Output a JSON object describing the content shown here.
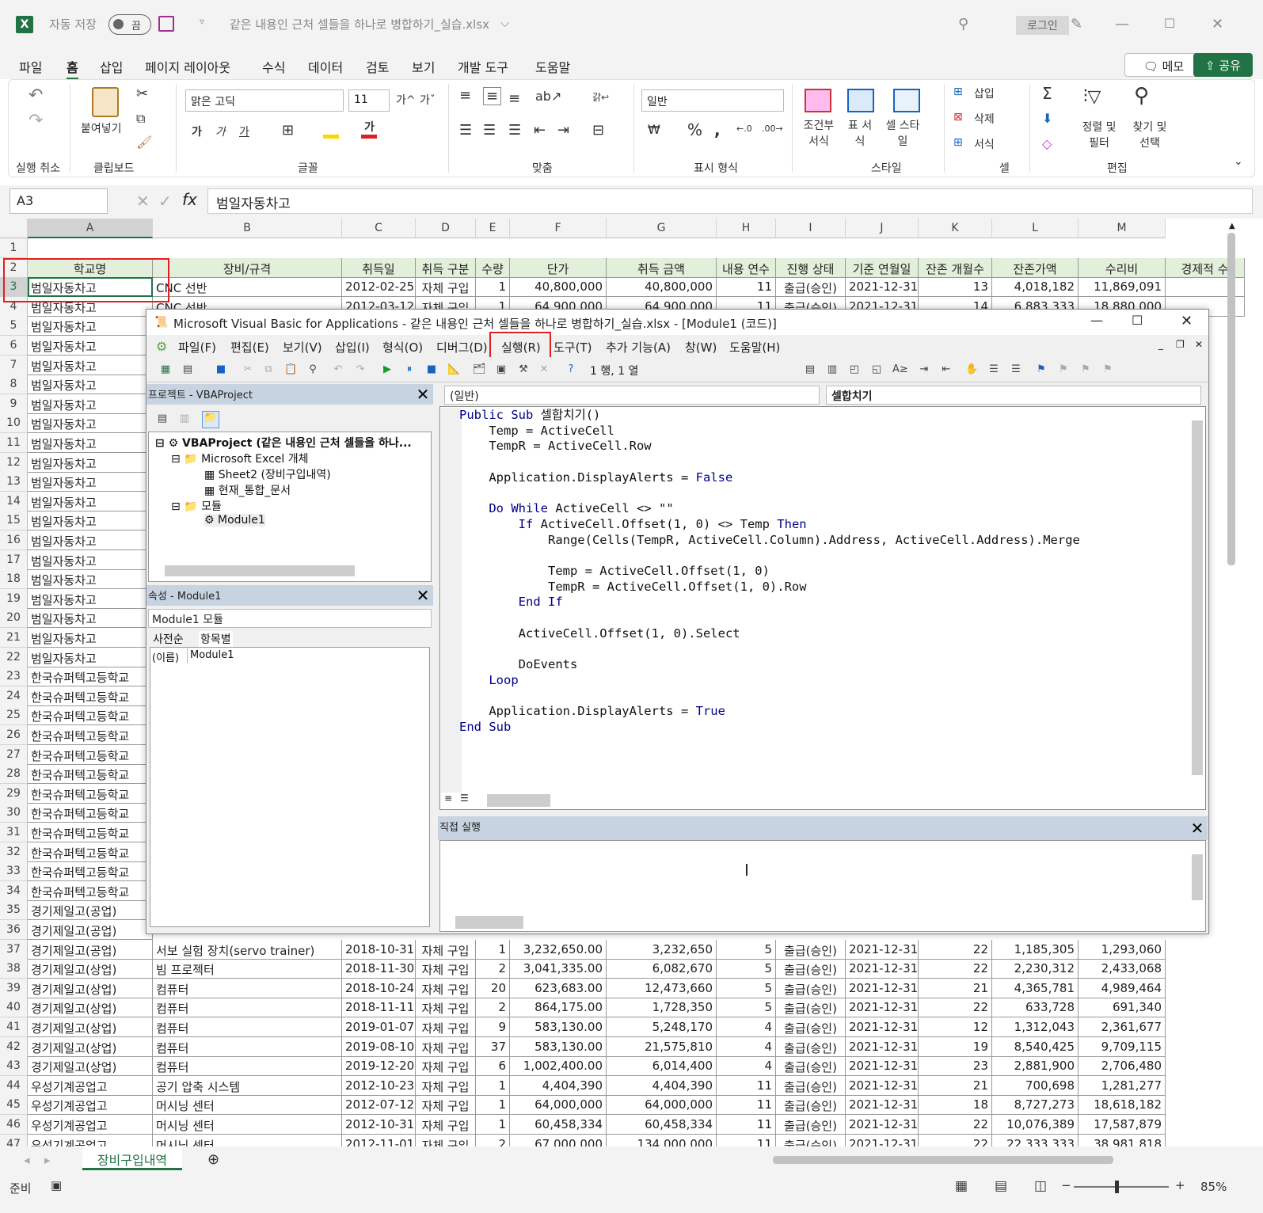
{
  "titlebar": {
    "autosave_label": "자동 저장",
    "autosave_state": "끔",
    "filename": "같은 내용인 근처 셀들을 하나로 병합하기_실습.xlsx",
    "login": "로그인"
  },
  "menu": {
    "tabs": [
      "파일",
      "홈",
      "삽입",
      "페이지 레이아웃",
      "수식",
      "데이터",
      "검토",
      "보기",
      "개발 도구",
      "도움말"
    ],
    "active": "홈",
    "memo": "메모",
    "share": "공유"
  },
  "ribbon": {
    "paste": "붙여넣기",
    "font_name": "맑은 고딕",
    "font_size": "11",
    "number_format": "일반",
    "conditional": "조건부 서식",
    "table": "표 서식",
    "cell_style": "셀 스타일",
    "insert": "삽입",
    "delete": "삭제",
    "format": "서식",
    "sort_filter": "정렬 및 필터",
    "find_select": "찾기 및 선택",
    "groups": {
      "undo": "실행 취소",
      "clipboard": "클립보드",
      "font": "글꼴",
      "align": "맞춤",
      "number": "표시 형식",
      "style": "스타일",
      "cells": "셀",
      "edit": "편집"
    }
  },
  "formula": {
    "namebox": "A3",
    "content": "범일자동차고"
  },
  "columns": [
    "A",
    "B",
    "C",
    "D",
    "E",
    "F",
    "G",
    "H",
    "I",
    "J",
    "K",
    "L",
    "M"
  ],
  "headers": [
    "학교명",
    "장비/규격",
    "취득일",
    "취득 구분",
    "수량",
    "단가",
    "취득 금액",
    "내용 연수",
    "진행 상태",
    "기준 연월일",
    "잔존 개월수",
    "잔존가액",
    "수리비",
    "경제적 수"
  ],
  "rows_top": [
    [
      "범일자동차고",
      "CNC 선반",
      "2012-02-25",
      "자체 구입",
      "1",
      "40,800,000",
      "40,800,000",
      "11",
      "출급(승인)",
      "2021-12-31",
      "13",
      "4,018,182",
      "11,869,091",
      ""
    ],
    [
      "범일자동차고",
      "CNC 선반",
      "2012-03-12",
      "자체 구입",
      "1",
      "64,900,000",
      "64,900,000",
      "11",
      "출급(승인)",
      "2021-12-31",
      "14",
      "6,883,333",
      "18,880,000",
      ""
    ]
  ],
  "colA_hidden": [
    "범일자동차고",
    "범일자동차고",
    "범일자동차고",
    "범일자동차고",
    "범일자동차고",
    "범일자동차고",
    "범일자동차고",
    "범일자동차고",
    "범일자동차고",
    "범일자동차고",
    "범일자동차고",
    "범일자동차고",
    "범일자동차고",
    "범일자동차고",
    "범일자동차고",
    "범일자동차고",
    "범일자동차고",
    "범일자동차고",
    "한국슈퍼텍고등학교",
    "한국슈퍼텍고등학교",
    "한국슈퍼텍고등학교",
    "한국슈퍼텍고등학교",
    "한국슈퍼텍고등학교",
    "한국슈퍼텍고등학교",
    "한국슈퍼텍고등학교",
    "한국슈퍼텍고등학교",
    "한국슈퍼텍고등학교",
    "한국슈퍼텍고등학교",
    "한국슈퍼텍고등학교",
    "한국슈퍼텍고등학교",
    "경기제일고(공업)",
    "경기제일고(공업)"
  ],
  "rows_bottom": [
    [
      "경기제일고(공업)",
      "서보 실험 장치(servo trainer)",
      "2018-10-31",
      "자체 구입",
      "1",
      "3,232,650.00",
      "3,232,650",
      "5",
      "출급(승인)",
      "2021-12-31",
      "22",
      "1,185,305",
      "1,293,060"
    ],
    [
      "경기제일고(상업)",
      "빔 프로젝터",
      "2018-11-30",
      "자체 구입",
      "2",
      "3,041,335.00",
      "6,082,670",
      "5",
      "출급(승인)",
      "2021-12-31",
      "22",
      "2,230,312",
      "2,433,068"
    ],
    [
      "경기제일고(상업)",
      "컴퓨터",
      "2018-10-24",
      "자체 구입",
      "20",
      "623,683.00",
      "12,473,660",
      "5",
      "출급(승인)",
      "2021-12-31",
      "21",
      "4,365,781",
      "4,989,464"
    ],
    [
      "경기제일고(상업)",
      "컴퓨터",
      "2018-11-11",
      "자체 구입",
      "2",
      "864,175.00",
      "1,728,350",
      "5",
      "출급(승인)",
      "2021-12-31",
      "22",
      "633,728",
      "691,340"
    ],
    [
      "경기제일고(상업)",
      "컴퓨터",
      "2019-01-07",
      "자체 구입",
      "9",
      "583,130.00",
      "5,248,170",
      "4",
      "출급(승인)",
      "2021-12-31",
      "12",
      "1,312,043",
      "2,361,677"
    ],
    [
      "경기제일고(상업)",
      "컴퓨터",
      "2019-08-10",
      "자체 구입",
      "37",
      "583,130.00",
      "21,575,810",
      "4",
      "출급(승인)",
      "2021-12-31",
      "19",
      "8,540,425",
      "9,709,115"
    ],
    [
      "경기제일고(상업)",
      "컴퓨터",
      "2019-12-20",
      "자체 구입",
      "6",
      "1,002,400.00",
      "6,014,400",
      "4",
      "출급(승인)",
      "2021-12-31",
      "23",
      "2,881,900",
      "2,706,480"
    ],
    [
      "우성기계공업고",
      "공기 압축 시스템",
      "2012-10-23",
      "자체 구입",
      "1",
      "4,404,390",
      "4,404,390",
      "11",
      "출급(승인)",
      "2021-12-31",
      "21",
      "700,698",
      "1,281,277"
    ],
    [
      "우성기계공업고",
      "머시닝 센터",
      "2012-07-12",
      "자체 구입",
      "1",
      "64,000,000",
      "64,000,000",
      "11",
      "출급(승인)",
      "2021-12-31",
      "18",
      "8,727,273",
      "18,618,182"
    ],
    [
      "우성기계공업고",
      "머시닝 센터",
      "2012-10-31",
      "자체 구입",
      "1",
      "60,458,334",
      "60,458,334",
      "11",
      "출급(승인)",
      "2021-12-31",
      "22",
      "10,076,389",
      "17,587,879"
    ],
    [
      "우성기계공업고",
      "머시닝 센터",
      "2012-11-01",
      "자체 구입",
      "2",
      "67,000,000",
      "134,000,000",
      "11",
      "출급(승인)",
      "2021-12-31",
      "22",
      "22,333,333",
      "38,981,818"
    ]
  ],
  "vba": {
    "title": "Microsoft Visual Basic for Applications - 같은 내용인 근처 셀들을 하나로 병합하기_실습.xlsx - [Module1 (코드)]",
    "menu": [
      "파일(F)",
      "편집(E)",
      "보기(V)",
      "삽입(I)",
      "형식(O)",
      "디버그(D)",
      "실행(R)",
      "도구(T)",
      "추가 기능(A)",
      "창(W)",
      "도움말(H)"
    ],
    "position": "1 행, 1 열",
    "project_title": "프로젝트 - VBAProject",
    "tree": [
      "VBAProject (같은 내용인 근처 셀들을 하나...",
      "Microsoft Excel 개체",
      "Sheet2 (장비구입내역)",
      "현재_통합_문서",
      "모듈",
      "Module1"
    ],
    "props_title": "속성 - Module1",
    "props_combo": "Module1 모듈",
    "props_tabs": [
      "사전순",
      "항목별"
    ],
    "props_name_key": "(이름)",
    "props_name_val": "Module1",
    "obj_combo": "(일반)",
    "proc_combo": "셀합치기",
    "code": [
      "Public Sub 셀합치기()",
      "    Temp = ActiveCell",
      "    TempR = ActiveCell.Row",
      "",
      "    Application.DisplayAlerts = False",
      "",
      "    Do While ActiveCell <> \"\"",
      "        If ActiveCell.Offset(1, 0) <> Temp Then",
      "            Range(Cells(TempR, ActiveCell.Column).Address, ActiveCell.Address).Merge",
      "",
      "            Temp = ActiveCell.Offset(1, 0)",
      "            TempR = ActiveCell.Offset(1, 0).Row",
      "        End If",
      "",
      "        ActiveCell.Offset(1, 0).Select",
      "",
      "        DoEvents",
      "    Loop",
      "",
      "    Application.DisplayAlerts = True",
      "End Sub"
    ],
    "immediate_title": "직접 실행"
  },
  "sheet": {
    "tab": "장비구입내역",
    "status": "준비",
    "zoom": "85%"
  },
  "colors": {
    "excel_green": "#217346",
    "highlight_red": "#e02020",
    "header_fill": "#e2efda"
  }
}
